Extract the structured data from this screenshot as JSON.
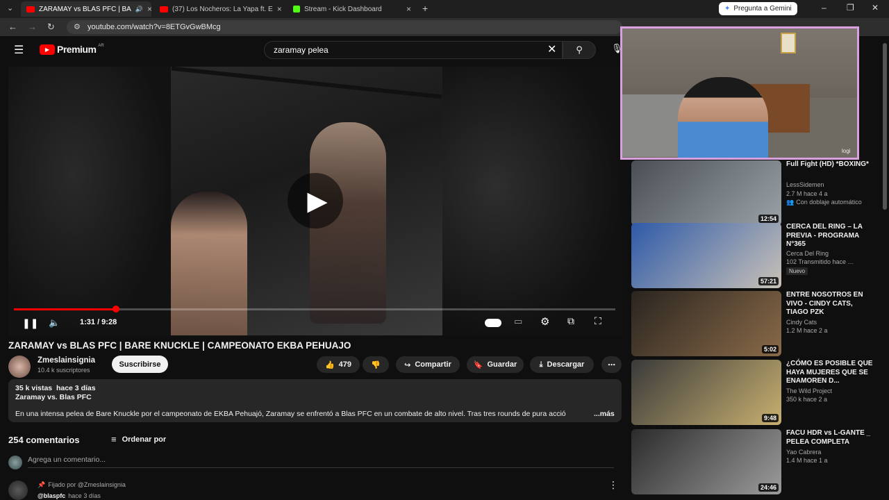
{
  "browser": {
    "tabs": [
      {
        "title": "ZARAMAY vs BLAS PFC | BA",
        "active": true,
        "favicon_color": "#ff0000"
      },
      {
        "title": "(37) Los Nocheros: La Yapa ft. E",
        "active": false,
        "favicon_color": "#ff0000"
      },
      {
        "title": "Stream - Kick Dashboard",
        "active": false,
        "favicon_color": "#53fc18"
      }
    ],
    "new_tab": "+",
    "gemini_button": "Pregunta a Gemini",
    "url": "youtube.com/watch?v=8ETGvGwBMcg"
  },
  "youtube": {
    "logo_text": "Premium",
    "logo_badge": "AR",
    "search_value": "zaramay pelea"
  },
  "player": {
    "time": "1:31 / 9:28",
    "progress": 0.17
  },
  "video": {
    "title": "ZARAMAY vs BLAS PFC | BARE KNUCKLE | CAMPEONATO EKBA PEHUAJO",
    "channel": "Zmeslainsignia",
    "subscribers": "10.4 k suscriptores",
    "subscribe_label": "Suscribirse",
    "likes": "479",
    "share_label": "Compartir",
    "save_label": "Guardar",
    "download_label": "Descargar"
  },
  "description": {
    "stats": "35 k vistas  hace 3 días",
    "subtitle": "Zaramay vs. Blas PFC",
    "text": "En una intensa pelea de Bare Knuckle por el campeonato de EKBA Pehuajó, Zaramay se enfrentó a Blas PFC en un combate de alto nivel. Tras tres rounds de pura acció",
    "more": "...más"
  },
  "comments": {
    "count_label": "254 comentarios",
    "sort_label": "Ordenar por",
    "add_placeholder": "Agrega un comentario...",
    "pinned_label": "Fijado por @Zmeslainsignia",
    "first_author": "@blaspfc",
    "first_time": "hace 3 días"
  },
  "webcam": {
    "label": "logi"
  },
  "recommendations": [
    {
      "title": "Full Fight (HD) *BOXING*",
      "channel": "LessSidemen",
      "meta": "2.7 M  hace 4 a",
      "extra": "Con doblaje automático",
      "duration": "12:54",
      "colors": [
        "#4a4f55",
        "#9aa2a8"
      ]
    },
    {
      "title": "CERCA DEL RING – LA PREVIA - PROGRAMA N°365",
      "channel": "Cerca Del Ring",
      "meta": "102  Transmitido hace …",
      "badge": "Nuevo",
      "duration": "57:21",
      "colors": [
        "#2e5aa8",
        "#c9c2b8"
      ]
    },
    {
      "title": "ENTRE NOSOTROS EN VIVO - CINDY CATS, TIAGO PZK",
      "channel": "Cindy Cats",
      "meta": "1.2 M  hace 2 a",
      "duration": "5:02",
      "colors": [
        "#2a2520",
        "#8a6a48"
      ]
    },
    {
      "title": "¿CÓMO ES POSIBLE QUE HAYA MUJERES QUE SE ENAMOREN D...",
      "channel": "The Wild Project",
      "meta": "350 k  hace 2 a",
      "duration": "9:48",
      "colors": [
        "#3a3a3a",
        "#c8b070"
      ]
    },
    {
      "title": "FACU HDR vs L-GANTE _ PELEA COMPLETA",
      "channel": "Yao Cabrera",
      "meta": "1.4 M  hace 1 a",
      "duration": "24:46",
      "colors": [
        "#2b2b2b",
        "#9c9c9c"
      ]
    }
  ]
}
